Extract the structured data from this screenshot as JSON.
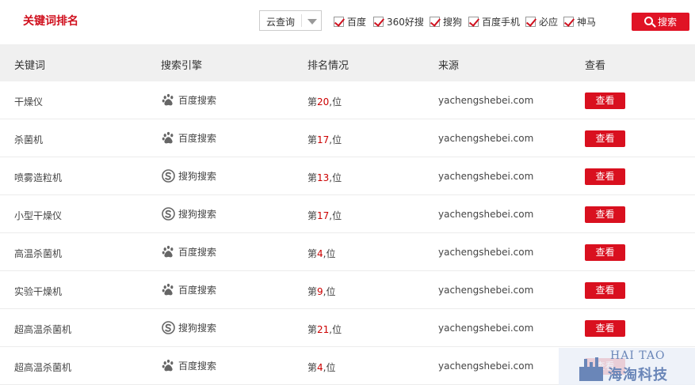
{
  "header": {
    "title": "关键词排名",
    "select_value": "云查询",
    "checkboxes": [
      {
        "label": "百度",
        "checked": true
      },
      {
        "label": "360好搜",
        "checked": true
      },
      {
        "label": "搜狗",
        "checked": true
      },
      {
        "label": "百度手机",
        "checked": true
      },
      {
        "label": "必应",
        "checked": true
      },
      {
        "label": "神马",
        "checked": true
      }
    ],
    "search_label": "搜索"
  },
  "table": {
    "columns": [
      "关键词",
      "搜索引擎",
      "排名情况",
      "来源",
      "查看"
    ],
    "rows": [
      {
        "keyword": "干燥仪",
        "engine": "百度搜索",
        "engine_icon": "baidu-paw-icon",
        "rank_prefix": "第",
        "rank": "20",
        "rank_suffix": ",位",
        "source": "yachengshebei.com",
        "view": "查看"
      },
      {
        "keyword": "杀菌机",
        "engine": "百度搜索",
        "engine_icon": "baidu-paw-icon",
        "rank_prefix": "第",
        "rank": "17",
        "rank_suffix": ",位",
        "source": "yachengshebei.com",
        "view": "查看"
      },
      {
        "keyword": "喷雾造粒机",
        "engine": "搜狗搜索",
        "engine_icon": "sogou-icon",
        "rank_prefix": "第",
        "rank": "13",
        "rank_suffix": ",位",
        "source": "yachengshebei.com",
        "view": "查看"
      },
      {
        "keyword": "小型干燥仪",
        "engine": "搜狗搜索",
        "engine_icon": "sogou-icon",
        "rank_prefix": "第",
        "rank": "17",
        "rank_suffix": ",位",
        "source": "yachengshebei.com",
        "view": "查看"
      },
      {
        "keyword": "高温杀菌机",
        "engine": "百度搜索",
        "engine_icon": "baidu-paw-icon",
        "rank_prefix": "第",
        "rank": "4",
        "rank_suffix": ",位",
        "source": "yachengshebei.com",
        "view": "查看"
      },
      {
        "keyword": "实验干燥机",
        "engine": "百度搜索",
        "engine_icon": "baidu-paw-icon",
        "rank_prefix": "第",
        "rank": "9",
        "rank_suffix": ",位",
        "source": "yachengshebei.com",
        "view": "查看"
      },
      {
        "keyword": "超高温杀菌机",
        "engine": "搜狗搜索",
        "engine_icon": "sogou-icon",
        "rank_prefix": "第",
        "rank": "21",
        "rank_suffix": ",位",
        "source": "yachengshebei.com",
        "view": "查看"
      },
      {
        "keyword": "超高温杀菌机",
        "engine": "百度搜索",
        "engine_icon": "baidu-paw-icon",
        "rank_prefix": "第",
        "rank": "4",
        "rank_suffix": ",位",
        "source": "yachengshebei.com",
        "view": "查看"
      }
    ]
  },
  "watermark": {
    "en": "HAI TAO",
    "cn": "海淘科技"
  },
  "colors": {
    "accent": "#d9101f",
    "header_bg": "#f0f0f0",
    "rank_number": "#cc0000"
  }
}
